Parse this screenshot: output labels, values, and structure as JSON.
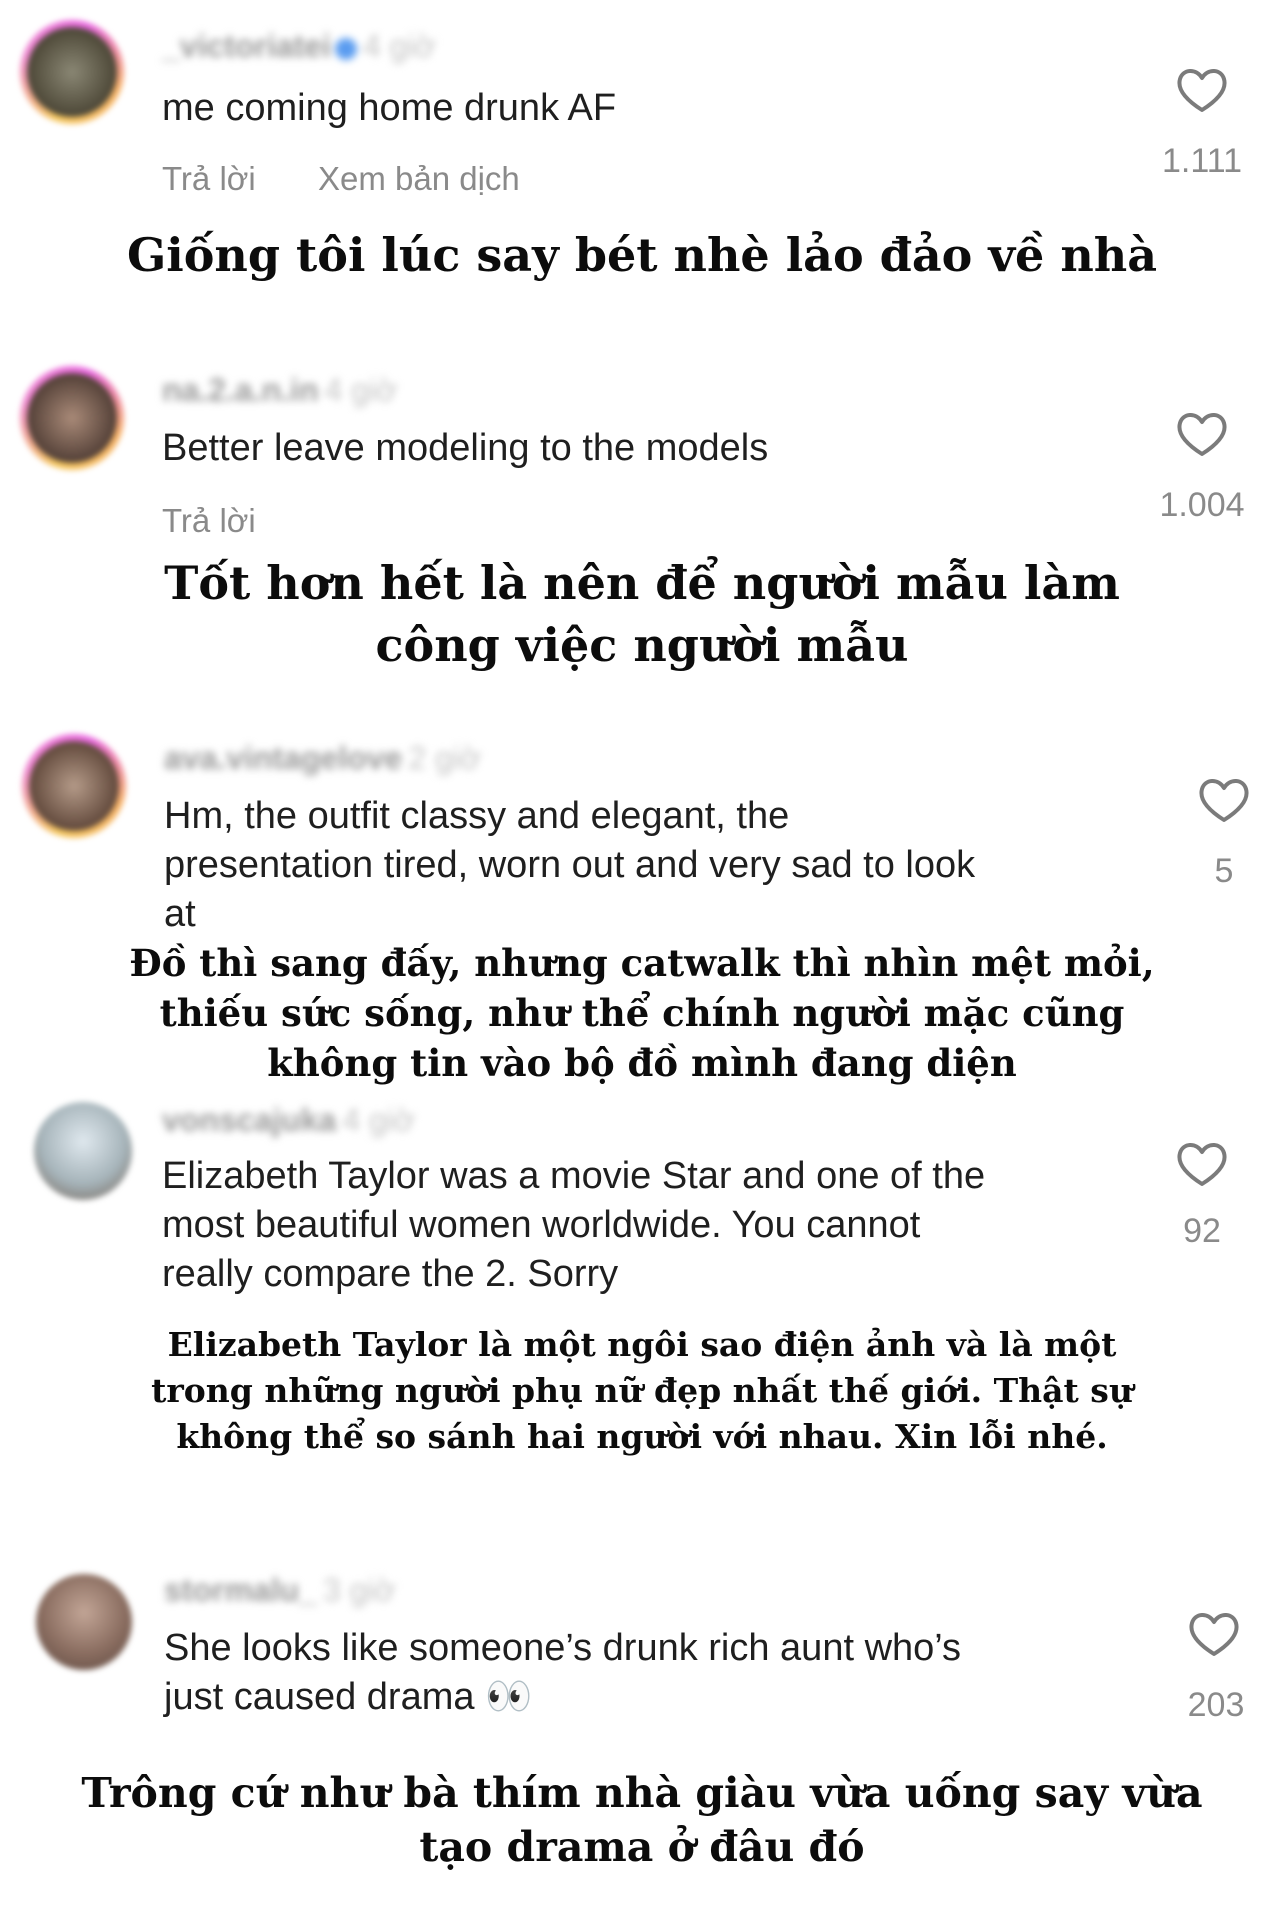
{
  "comments": [
    {
      "username": "_victoriatei",
      "time": "4 giờ",
      "text_lines": [
        "me coming home drunk AF"
      ],
      "reply_label": "Trả lời",
      "translate_label": "Xem bản dịch",
      "likes": "1.111",
      "avatar_colors": [
        "#8a8774",
        "#55503f",
        "#2f2c24"
      ],
      "translation_lines": [
        "Giống tôi lúc say bét nhè lảo đảo về nhà"
      ]
    },
    {
      "username": "na.2.a.n.in",
      "time": "4 giờ",
      "text_lines": [
        "Better leave modeling to the models"
      ],
      "reply_label": "Trả lời",
      "likes": "1.004",
      "avatar_colors": [
        "#a98a78",
        "#5f4a40",
        "#2e2522"
      ],
      "translation_lines": [
        "Tốt hơn hết là nên để người mẫu làm",
        "công việc người mẫu"
      ]
    },
    {
      "username": "ava.vintagelove",
      "time": "2 giờ",
      "text_lines": [
        "Hm, the outfit classy and elegant, the",
        "presentation tired, worn out and very sad to look",
        "at"
      ],
      "likes": "5",
      "avatar_colors": [
        "#b49a88",
        "#6d5446",
        "#3a2b24"
      ],
      "translation_lines": [
        "Đồ thì sang đấy, nhưng catwalk thì nhìn mệt mỏi,",
        "thiếu sức sống, như thể chính người mặc cũng",
        "không tin vào bộ đồ mình đang diện"
      ]
    },
    {
      "username": "vonscajuka",
      "time": "4 giờ",
      "text_lines": [
        "Elizabeth Taylor was a movie Star and one of the",
        "most beautiful women worldwide. You cannot",
        "really compare the 2. Sorry"
      ],
      "likes": "92",
      "avatar_colors": [
        "#dfe8ee",
        "#a6b4ba",
        "#6e5c4e"
      ],
      "translation_lines": [
        "Elizabeth Taylor là một ngôi sao điện ảnh và là một",
        "trong những người phụ nữ đẹp nhất thế giới. Thật sự",
        "không thể so sánh hai người với nhau. Xin lỗi nhé."
      ]
    },
    {
      "username": "stormalu_",
      "time": "3 giờ",
      "text_lines": [
        "She looks like someone’s drunk rich aunt who’s",
        "just caused drama 👀"
      ],
      "likes": "203",
      "avatar_colors": [
        "#c2a596",
        "#8a6d60",
        "#5a463e"
      ],
      "translation_lines": [
        "Trông cứ như bà thím nhà giàu vừa uống say vừa",
        "tạo drama ở đâu đó"
      ]
    }
  ],
  "icons": {
    "like": "heart-outline-icon",
    "verified": "verified-badge-icon"
  }
}
